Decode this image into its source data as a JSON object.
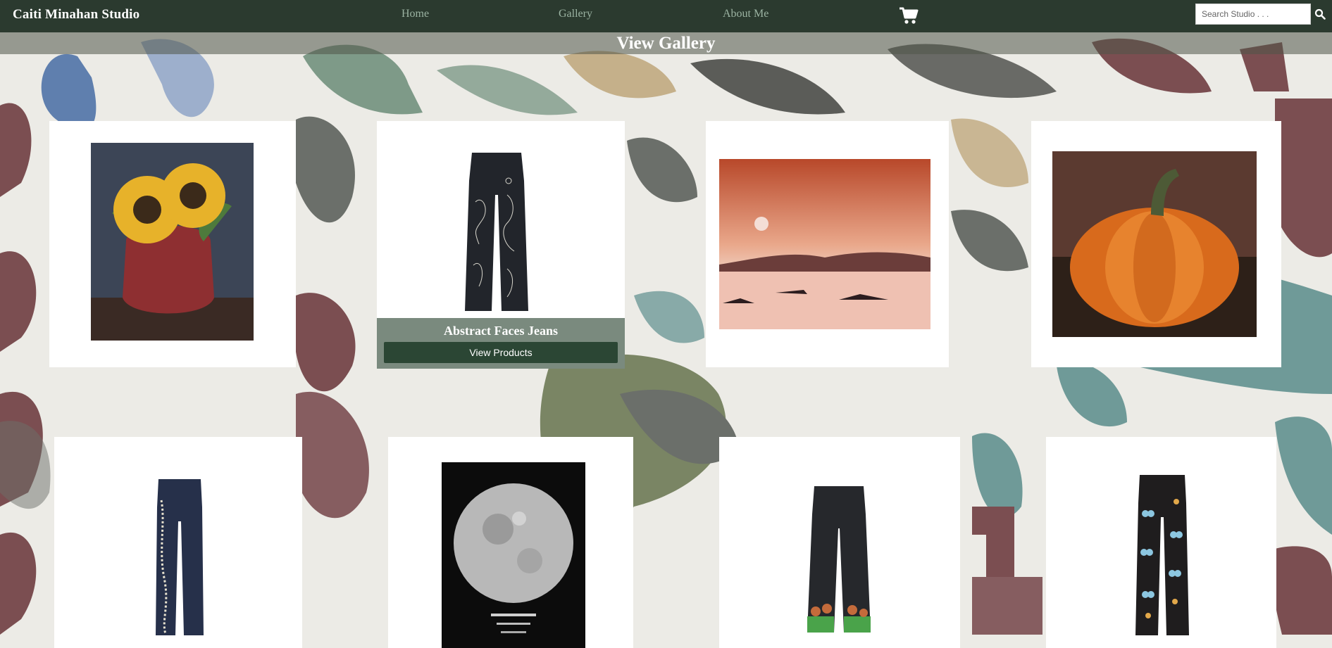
{
  "header": {
    "brand": "Caiti Minahan Studio",
    "nav": [
      {
        "label": "Home"
      },
      {
        "label": "Gallery"
      },
      {
        "label": "About Me"
      }
    ],
    "cart_icon": "shopping-cart-icon",
    "search": {
      "placeholder": "Search Studio . . .",
      "value": "",
      "icon": "search-icon"
    }
  },
  "gallery": {
    "title": "View Gallery"
  },
  "cards": [
    {
      "name": "sunflowers-painting"
    },
    {
      "name": "abstract-faces-jeans",
      "title": "Abstract Faces Jeans",
      "button": "View Products"
    },
    {
      "name": "sunset-lake-painting"
    },
    {
      "name": "pumpkin-painting"
    },
    {
      "name": "embroidered-vine-jeans"
    },
    {
      "name": "full-moon-painting"
    },
    {
      "name": "mushroom-hem-jeans"
    },
    {
      "name": "butterfly-jeans"
    }
  ],
  "colors": {
    "nav_bg": "#2b3a2f",
    "nav_link": "#9bb3a2",
    "button_bg": "#2b4634",
    "overlay_bg": "#7a8a7e"
  }
}
